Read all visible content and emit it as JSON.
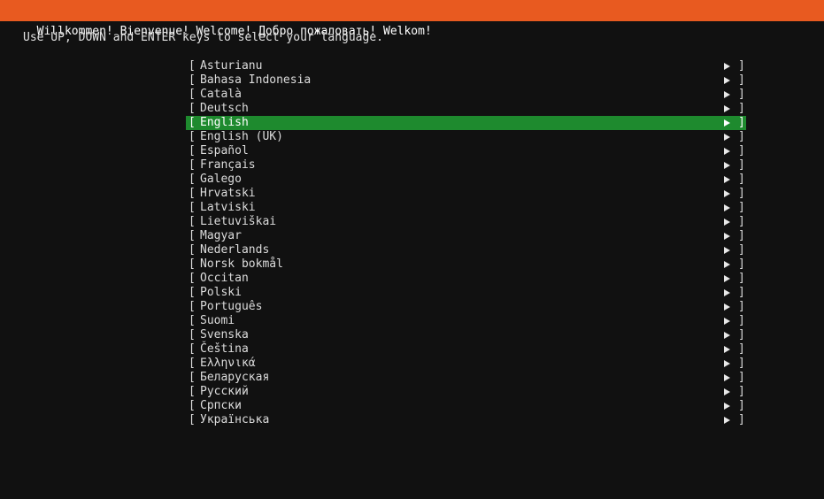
{
  "header": {
    "title": "Willkommen! Bienvenue! Welcome! Добро пожаловать! Welkom!"
  },
  "instructions": "Use UP, DOWN and ENTER keys to select your language.",
  "list": {
    "open_bracket": "[",
    "close_bracket": "]",
    "arrow_icon": "right-triangle",
    "selected_index": 4,
    "highlight_color": "#1e8a2e",
    "items": [
      {
        "label": "Asturianu"
      },
      {
        "label": "Bahasa Indonesia"
      },
      {
        "label": "Català"
      },
      {
        "label": "Deutsch"
      },
      {
        "label": "English"
      },
      {
        "label": "English (UK)"
      },
      {
        "label": "Español"
      },
      {
        "label": "Français"
      },
      {
        "label": "Galego"
      },
      {
        "label": "Hrvatski"
      },
      {
        "label": "Latviski"
      },
      {
        "label": "Lietuviškai"
      },
      {
        "label": "Magyar"
      },
      {
        "label": "Nederlands"
      },
      {
        "label": "Norsk bokmål"
      },
      {
        "label": "Occitan"
      },
      {
        "label": "Polski"
      },
      {
        "label": "Português"
      },
      {
        "label": "Suomi"
      },
      {
        "label": "Svenska"
      },
      {
        "label": "Čeština"
      },
      {
        "label": "Ελληνικά"
      },
      {
        "label": "Беларуская"
      },
      {
        "label": "Русский"
      },
      {
        "label": "Српски"
      },
      {
        "label": "Українська"
      }
    ]
  },
  "colors": {
    "title_bar": "#e85a20",
    "background": "#111111",
    "selection": "#1e8a2e"
  }
}
